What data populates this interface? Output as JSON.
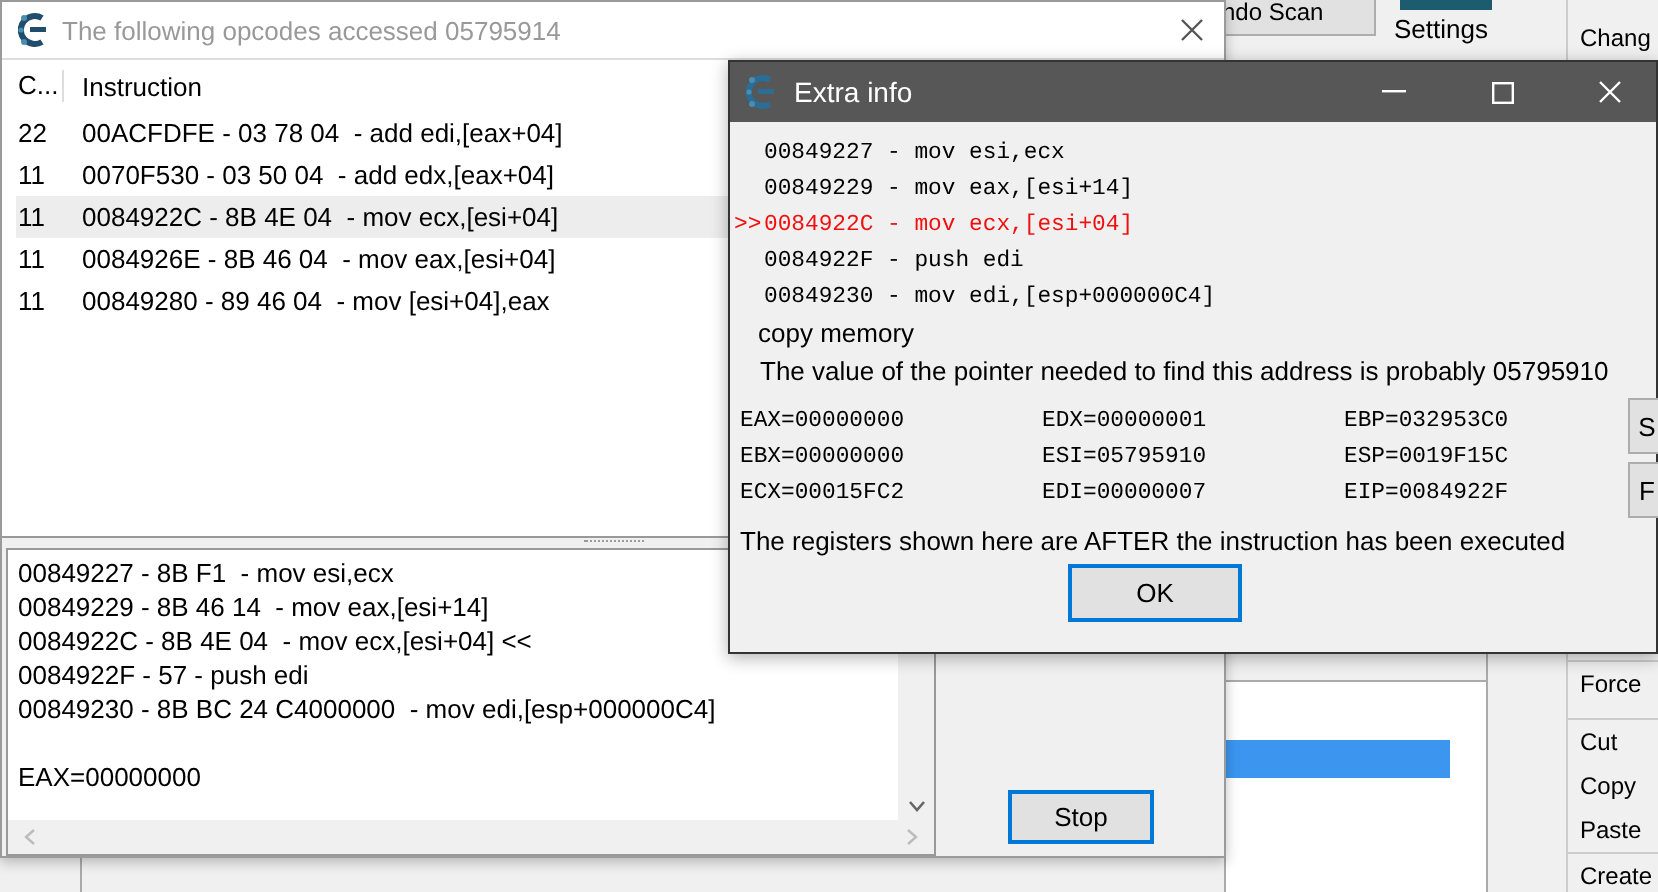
{
  "background_app": {
    "scan_button": "ndo Scan",
    "settings_label": "Settings",
    "menu_items": [
      {
        "label": "Chang",
        "kind": "item"
      },
      {
        "label": "Force",
        "kind": "item"
      },
      {
        "label": "Cut",
        "kind": "item"
      },
      {
        "label": "Copy",
        "kind": "item"
      },
      {
        "label": "Paste",
        "kind": "item"
      },
      {
        "label": "Create",
        "kind": "item"
      }
    ],
    "list_rows": [
      {
        "selected": true
      }
    ]
  },
  "opcodes_window": {
    "title": "The following opcodes accessed 05795914",
    "columns": [
      "C...",
      "Instruction"
    ],
    "rows": [
      {
        "count": "22",
        "instruction": "00ACFDFE - 03 78 04  - add edi,[eax+04]",
        "selected": false
      },
      {
        "count": "11",
        "instruction": "0070F530 - 03 50 04  - add edx,[eax+04]",
        "selected": false
      },
      {
        "count": "11",
        "instruction": "0084922C - 8B 4E 04  - mov ecx,[esi+04]",
        "selected": true
      },
      {
        "count": "11",
        "instruction": "0084926E - 8B 46 04  - mov eax,[esi+04]",
        "selected": false
      },
      {
        "count": "11",
        "instruction": "00849280 - 89 46 04  - mov [esi+04],eax",
        "selected": false
      }
    ],
    "details": [
      "00849227 - 8B F1  - mov esi,ecx",
      "00849229 - 8B 46 14  - mov eax,[esi+14]",
      "0084922C - 8B 4E 04  - mov ecx,[esi+04] <<",
      "0084922F - 57 - push edi",
      "00849230 - 8B BC 24 C4000000  - mov edi,[esp+000000C4]"
    ],
    "register_line": "EAX=00000000",
    "stop_button": "Stop"
  },
  "extra_info": {
    "title": "Extra info",
    "code_lines": [
      {
        "text": "00849227 - mov esi,ecx",
        "current": false
      },
      {
        "text": "00849229 - mov eax,[esi+14]",
        "current": false
      },
      {
        "marker": ">>",
        "text": "0084922C - mov ecx,[esi+04]",
        "current": true
      },
      {
        "text": "0084922F - push edi",
        "current": false
      },
      {
        "text": "00849230 - mov edi,[esp+000000C4]",
        "current": false
      }
    ],
    "copy_memory": "copy memory",
    "pointer_note": "The value of the pointer needed to find this address is probably 05795910",
    "registers": [
      "EAX=00000000",
      "EDX=00000001",
      "EBP=032953C0",
      "EBX=00000000",
      "ESI=05795910",
      "ESP=0019F15C",
      "ECX=00015FC2",
      "EDI=00000007",
      "EIP=0084922F"
    ],
    "side_buttons": [
      "S",
      "F"
    ],
    "note": "The registers shown here are AFTER the instruction has been executed",
    "ok_button": "OK"
  }
}
